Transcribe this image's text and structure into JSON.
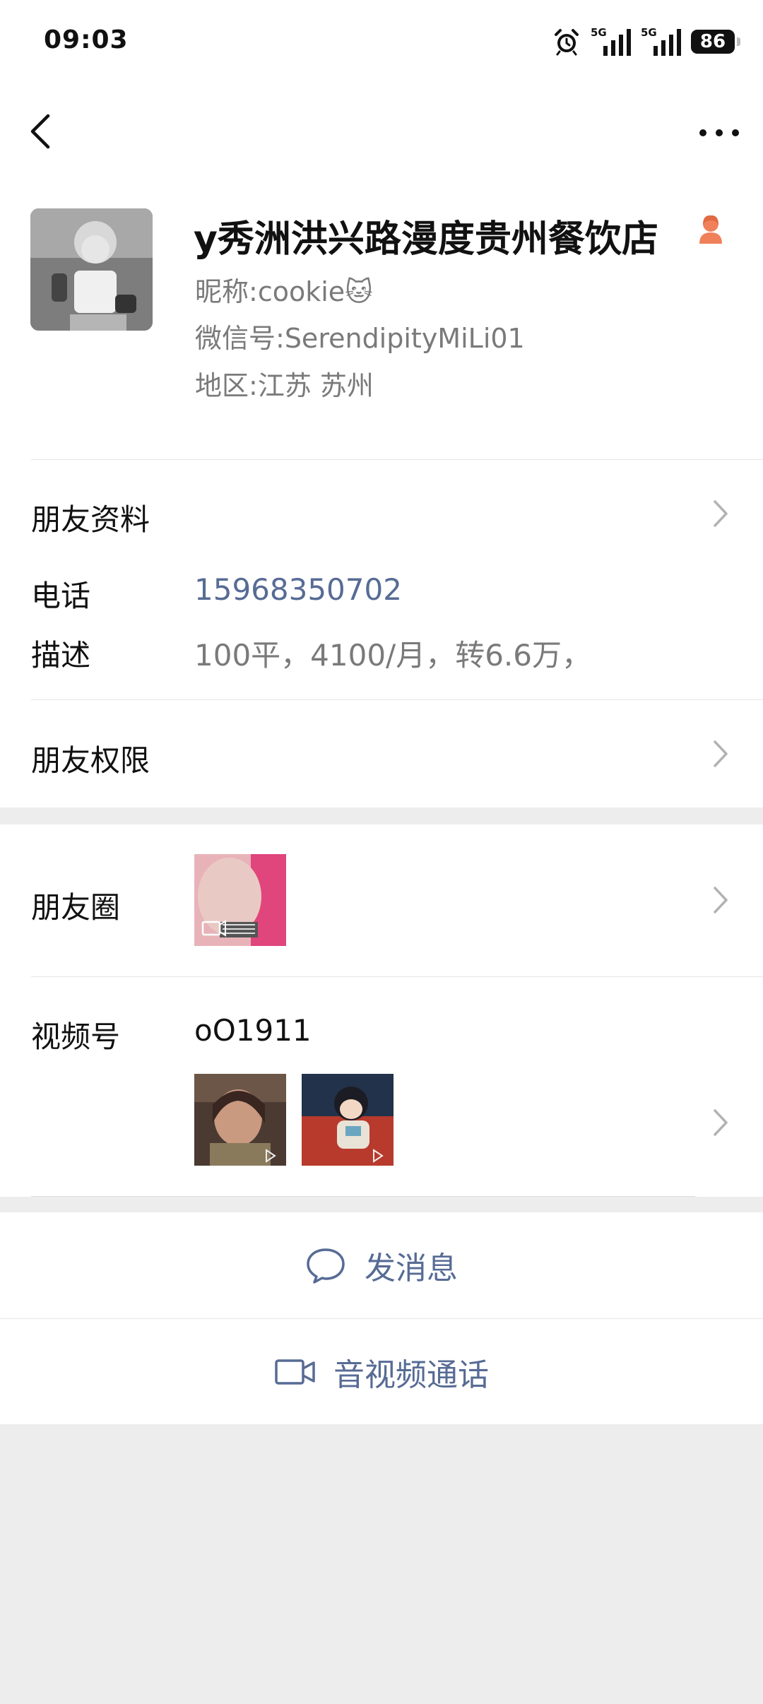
{
  "status_bar": {
    "time": "09:03",
    "signal_1_label": "5G",
    "signal_2_label": "5G",
    "battery": "86",
    "icons": [
      "alarm-icon",
      "signal-icon",
      "signal-icon",
      "battery-icon"
    ]
  },
  "nav": {
    "back_icon": "chevron-left-icon",
    "more_icon": "more-horizontal-icon"
  },
  "profile": {
    "name": "y秀洲洪兴路漫度贵州餐饮店",
    "nickname_label": "昵称:",
    "nickname_value": "cookie🐱",
    "wechat_id_label": "微信号:",
    "wechat_id_value": "SerendipityMiLi01",
    "region_label": "地区:",
    "region_value": "江苏  苏州",
    "gender_icon": "female-person-icon",
    "gender_color": "#f0805a"
  },
  "sections": {
    "friend_profile": "朋友资料",
    "phone_label": "电话",
    "phone_value": "15968350702",
    "description_label": "描述",
    "description_value": "100平，4100/月，转6.6万，",
    "friend_permissions": "朋友权限",
    "moments_label": "朋友圈",
    "channels_label": "视频号",
    "channels_value": "oO1911"
  },
  "actions": {
    "send_message": "发消息",
    "send_message_icon": "chat-bubble-icon",
    "video_call": "音视频通话",
    "video_call_icon": "video-camera-icon"
  },
  "colors": {
    "link": "#576b95",
    "background": "#ededed",
    "secondary_text": "#7a7a7a"
  }
}
